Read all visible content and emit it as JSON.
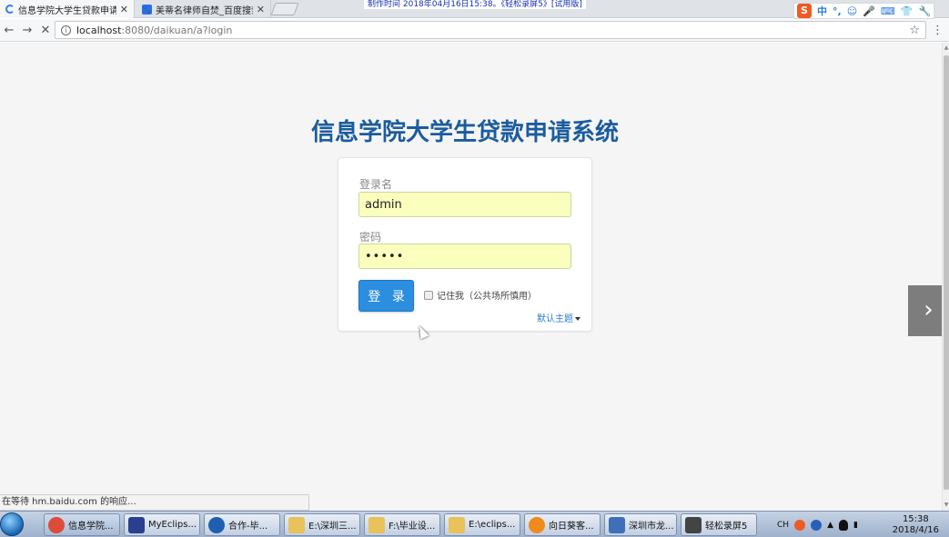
{
  "browser": {
    "tabs": [
      {
        "label": "信息学院大学生贷款申请",
        "active": true
      },
      {
        "label": "美蒂名律师自焚_百度搜索",
        "active": false
      }
    ],
    "recording_watermark": "制作时间 2018年04月16日15:38。《轻松录屏5》[试用版]",
    "ime_items": [
      "S",
      "中",
      "°,",
      "☺",
      "🎤",
      "⌨",
      "👕",
      "🔧"
    ],
    "url_host": "localhost",
    "url_rest": ":8080/daikuan/a?login",
    "status_text": "在等待 hm.baidu.com 的响应..."
  },
  "login": {
    "title": "信息学院大学生贷款申请系统",
    "username_label": "登录名",
    "username_value": "admin",
    "password_label": "密码",
    "password_value": "•••••",
    "login_button": "登 录",
    "remember_label": "记住我（公共场所慎用）",
    "theme_label": "默认主题"
  },
  "taskbar": {
    "items": [
      {
        "label": "信息学院...",
        "color": "#dd4b39"
      },
      {
        "label": "MyEclips...",
        "color": "#2b3f8f"
      },
      {
        "label": "合作-毕...",
        "color": "#1f5fb0"
      },
      {
        "label": "E:\\深圳三...",
        "color": "#e8c25a"
      },
      {
        "label": "F:\\毕业设...",
        "color": "#e8c25a"
      },
      {
        "label": "E:\\eclips...",
        "color": "#e8c25a"
      },
      {
        "label": "向日葵客...",
        "color": "#f08a1c"
      },
      {
        "label": "深圳市龙...",
        "color": "#3f6fb6"
      },
      {
        "label": "轻松录屏5",
        "color": "#444444"
      }
    ],
    "tray_lang": "CH",
    "clock_time": "15:38",
    "clock_date": "2018/4/16"
  }
}
